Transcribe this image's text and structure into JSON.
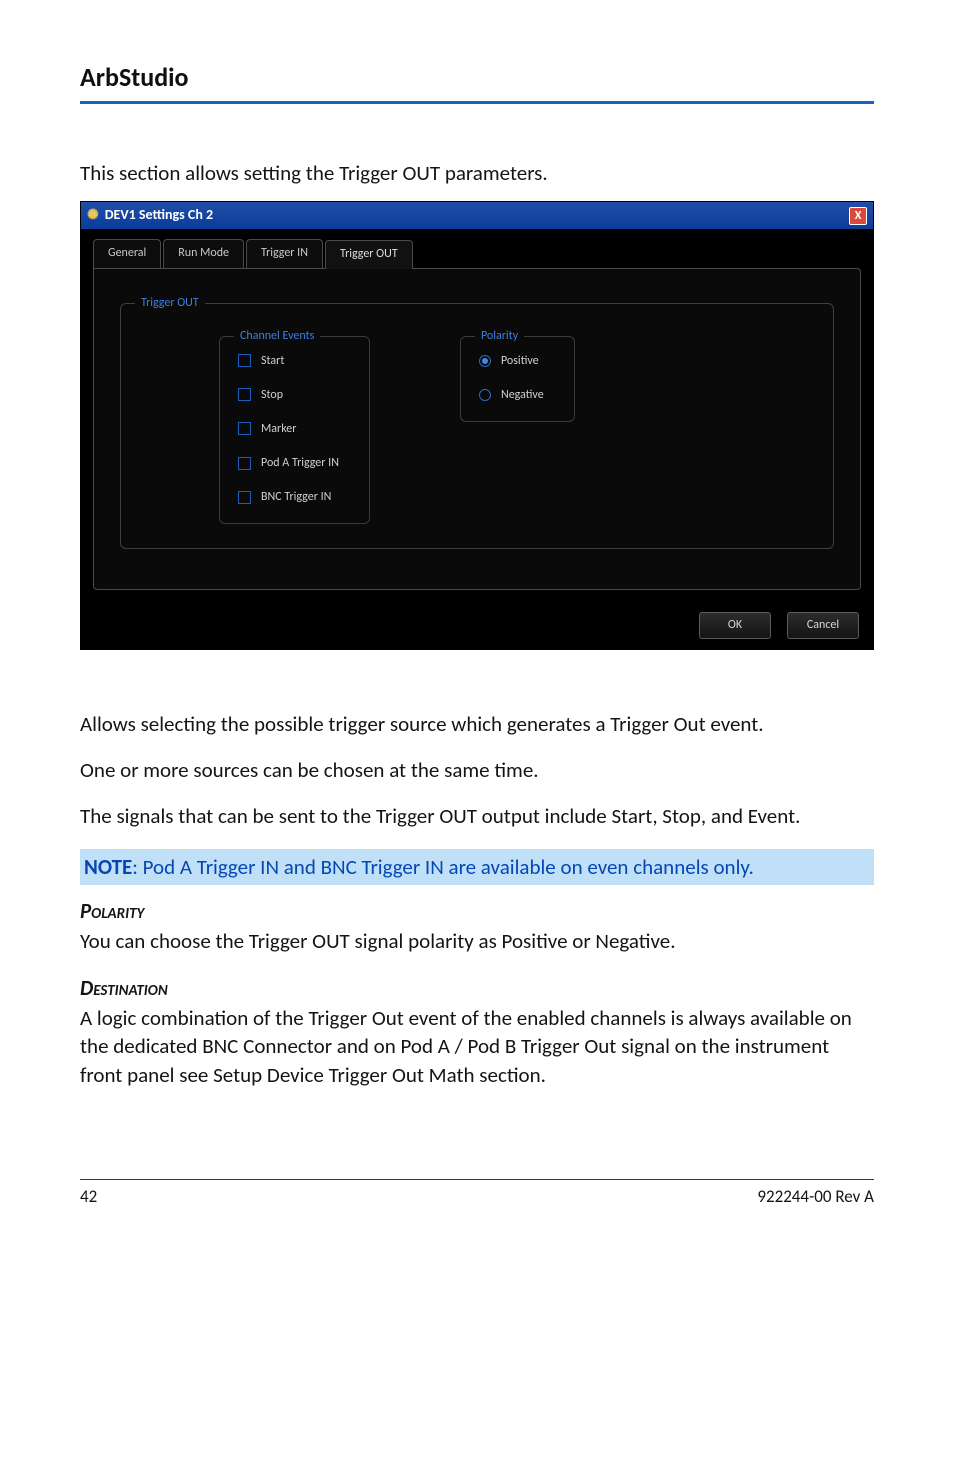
{
  "page": {
    "title": "ArbStudio",
    "intro": "This section allows setting the Trigger OUT parameters.",
    "footer_left": "42",
    "footer_right": "922244-00 Rev A"
  },
  "dialog": {
    "title": "DEV1 Settings Ch 2",
    "close": "X",
    "tabs": {
      "general": "General",
      "run_mode": "Run Mode",
      "trigger_in": "Trigger IN",
      "trigger_out": "Trigger OUT"
    },
    "group_trigger_out": "Trigger OUT",
    "group_channel_events": "Channel Events",
    "group_polarity": "Polarity",
    "checks": {
      "start": "Start",
      "stop": "Stop",
      "marker": "Marker",
      "pod_a": "Pod A Trigger IN",
      "bnc": "BNC Trigger IN"
    },
    "radios": {
      "positive": "Positive",
      "negative": "Negative"
    },
    "buttons": {
      "ok": "OK",
      "cancel": "Cancel"
    }
  },
  "body": {
    "p1": "Allows selecting the possible trigger source which generates a Trigger Out event.",
    "p2": "One or more sources can be chosen at the same time.",
    "p3": "The signals that can be sent to the Trigger OUT output include Start, Stop, and Event.",
    "note_label": "NOTE",
    "note_text": ": Pod A Trigger IN and BNC Trigger IN are available on even channels only.",
    "polarity_head": "Polarity",
    "polarity_text": "You can choose the Trigger OUT signal polarity as Positive or Negative.",
    "dest_head": "Destination",
    "dest_text": "A logic combination of the Trigger Out event of the enabled channels is always available on the dedicated BNC Connector and on Pod A / Pod B Trigger Out signal on the instrument front panel see Setup Device Trigger Out Math section."
  }
}
